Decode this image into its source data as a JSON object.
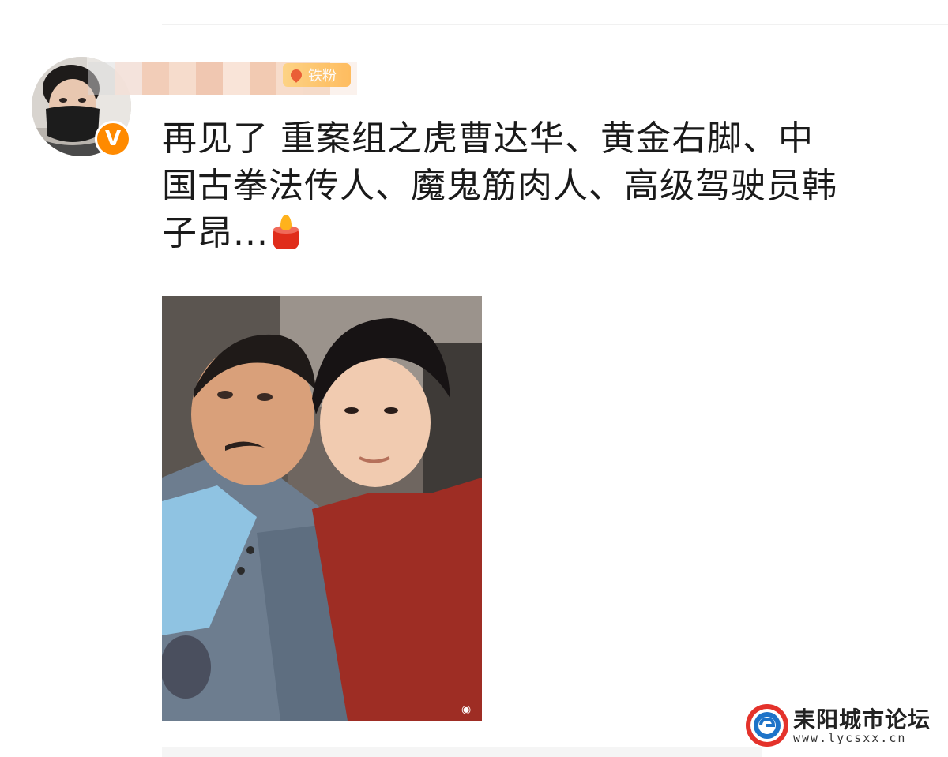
{
  "post": {
    "author_badge": "铁粉",
    "text_lines": [
      "再见了 重案组之虎曹达华、黄金右脚、中",
      "国古拳法传人、魔鬼筋肉人、高级驾驶员韩",
      "子昂..."
    ],
    "emoji_icon": "candle-icon",
    "verified_mark": "V"
  },
  "watermark": {
    "site_name": "耒阳城市论坛",
    "site_url": "www.lycsxx.cn"
  },
  "colors": {
    "verified": "#ff8a00",
    "fan_badge": "#ffb347",
    "candle": "#e02d1b"
  }
}
